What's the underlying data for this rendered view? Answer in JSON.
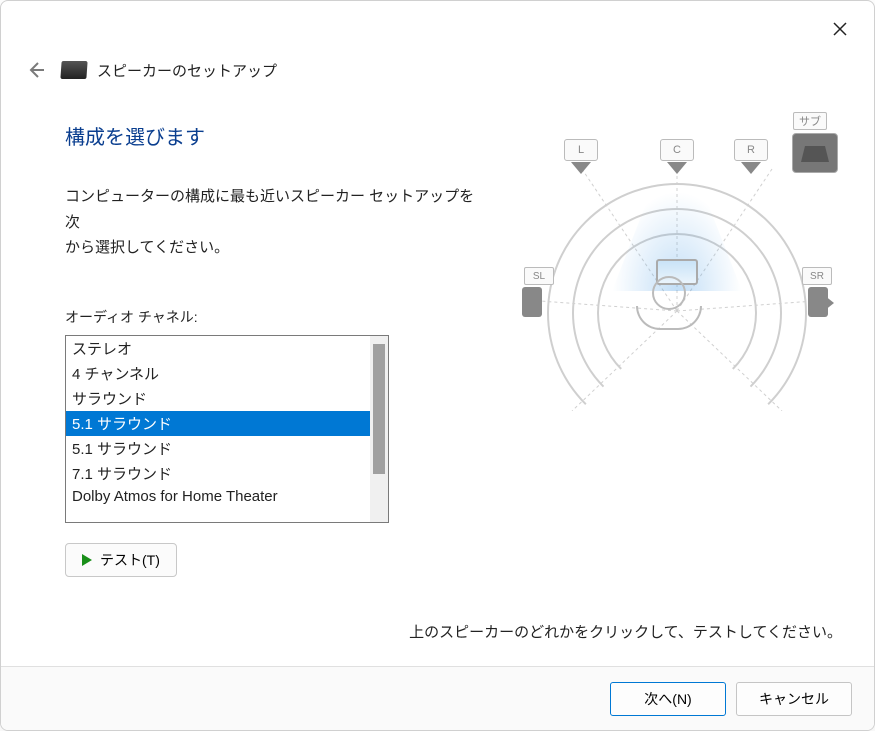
{
  "window": {
    "title": "スピーカーのセットアップ"
  },
  "page": {
    "heading": "構成を選びます",
    "description_line1": "コンピューターの構成に最も近いスピーカー セットアップを次",
    "description_line2": "から選択してください。",
    "listbox_label": "オーディオ チャネル:",
    "channels": {
      "0": "ステレオ",
      "1": "4 チャンネル",
      "2": "サラウンド",
      "3": "5.1 サラウンド",
      "4": "5.1 サラウンド",
      "5": "7.1 サラウンド",
      "6": "Dolby Atmos for Home Theater"
    },
    "selected_index": 3,
    "test_button": "テスト(T)"
  },
  "diagram": {
    "labels": {
      "L": "L",
      "C": "C",
      "R": "R",
      "SL": "SL",
      "SR": "SR",
      "SUB": "サブ"
    },
    "hint": "上のスピーカーのどれかをクリックして、テストしてください。"
  },
  "footer": {
    "next": "次へ(N)",
    "cancel": "キャンセル"
  }
}
